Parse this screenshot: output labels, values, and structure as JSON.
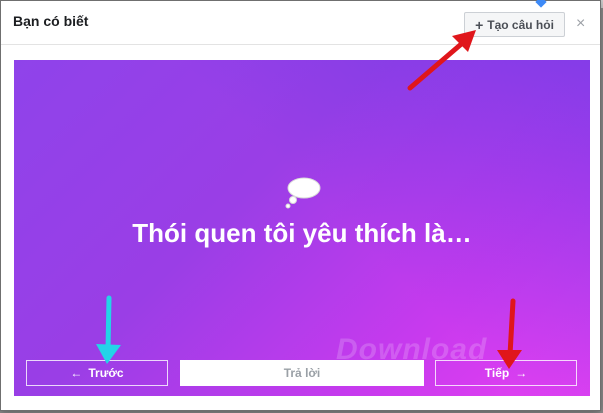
{
  "dialog": {
    "title": "Bạn có biết",
    "create_button": "Tạo câu hỏi",
    "close_symbol": "×"
  },
  "card": {
    "question": "Thói quen tôi yêu thích là…",
    "gradient": [
      "#8f43ea",
      "#e640f2"
    ]
  },
  "nav": {
    "prev_label": "Trước",
    "answer_label": "Trả lời",
    "next_label": "Tiếp"
  },
  "watermark": "Download",
  "annotation_colors": {
    "red_arrow": "#e0161b",
    "cyan_arrow": "#23d4e8"
  }
}
